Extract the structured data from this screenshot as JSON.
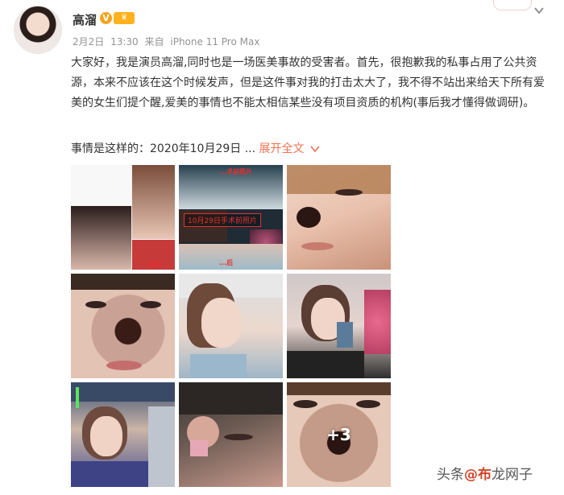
{
  "user": {
    "name": "高溜",
    "verified_icon": "verified-v-icon",
    "vip_icon": "vip-icon"
  },
  "post_meta": {
    "date": "2月2日",
    "time": "13:30",
    "source_prefix": "来自",
    "source_device": "iPhone 11 Pro Max"
  },
  "post": {
    "text": "大家好，我是演员高溜,同时也是一场医美事故的受害者。首先，很抱歉我的私事占用了公共资源，本来不应该在这个时候发声，但是这件事对我的打击太大了，我不得不站出来给天下所有爱美的女生们提个醒,爱美的事情也不能太相信某些没有项目资质的机构(事后我才懂得做调研)。",
    "last_line": "事情是这样的：2020年10月29日 ...",
    "expand_label": "展开全文",
    "expand_icon": "chevron-down-icon"
  },
  "photos": {
    "images": [
      {
        "id": 1,
        "caption": "...照片",
        "description": "portrait collage"
      },
      {
        "id": 2,
        "caption": "10月29日手术前照片",
        "caption_top": "...术前照片",
        "caption_bottom": "...后"
      },
      {
        "id": 3
      },
      {
        "id": 4
      },
      {
        "id": 5
      },
      {
        "id": 6
      },
      {
        "id": 7
      },
      {
        "id": 8
      },
      {
        "id": 9,
        "more_label": "+3"
      }
    ]
  },
  "watermark": {
    "prefix": "头条",
    "accent": "@布",
    "rest": "龙网子"
  },
  "colors": {
    "link": "#eb7350",
    "meta_gray": "#939393",
    "text": "#333333"
  }
}
